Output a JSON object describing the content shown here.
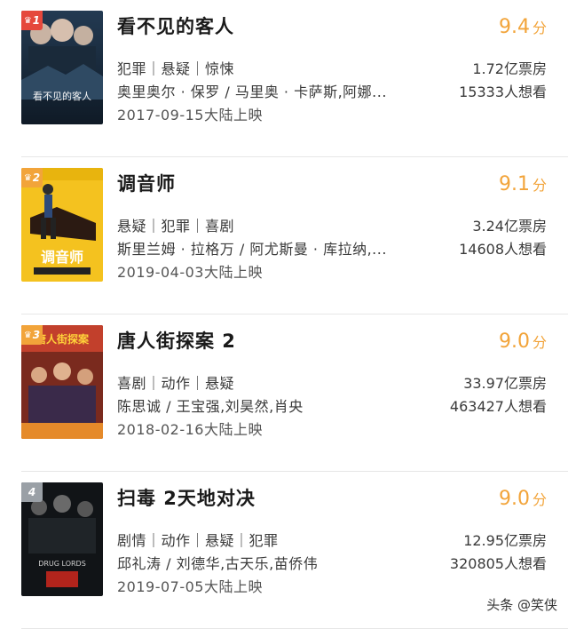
{
  "movies": [
    {
      "rank": "1",
      "title": "看不见的客人",
      "score": "9.4",
      "score_unit": "分",
      "genres": "犯罪｜悬疑｜惊悚",
      "cast": "奥里奥尔 · 保罗 / 马里奥 · 卡萨斯,阿娜...",
      "release": "2017-09-15大陆上映",
      "box_office": "1.72亿票房",
      "wants": "15333人想看",
      "poster_text": "看不见的客人",
      "rank_color": "#e5483c"
    },
    {
      "rank": "2",
      "title": "调音师",
      "score": "9.1",
      "score_unit": "分",
      "genres": "悬疑｜犯罪｜喜剧",
      "cast": "斯里兰姆 · 拉格万 / 阿尤斯曼 · 库拉纳,...",
      "release": "2019-04-03大陆上映",
      "box_office": "3.24亿票房",
      "wants": "14608人想看",
      "poster_text": "调音师",
      "rank_color": "#f2a43a"
    },
    {
      "rank": "3",
      "title": "唐人街探案 2",
      "score": "9.0",
      "score_unit": "分",
      "genres": "喜剧｜动作｜悬疑",
      "cast": "陈思诚 / 王宝强,刘昊然,肖央",
      "release": "2018-02-16大陆上映",
      "box_office": "33.97亿票房",
      "wants": "463427人想看",
      "poster_text": "唐人街探案",
      "rank_color": "#f2a43a"
    },
    {
      "rank": "4",
      "title": "扫毒 2天地对决",
      "score": "9.0",
      "score_unit": "分",
      "genres": "剧情｜动作｜悬疑｜犯罪",
      "cast": "邱礼涛 / 刘德华,古天乐,苗侨伟",
      "release": "2019-07-05大陆上映",
      "box_office": "12.95亿票房",
      "wants": "320805人想看",
      "poster_text": "DRUG LORDS",
      "rank_color": "#9aa0a6"
    }
  ],
  "watermark": {
    "left": "头条",
    "handle": "@笑侠"
  }
}
